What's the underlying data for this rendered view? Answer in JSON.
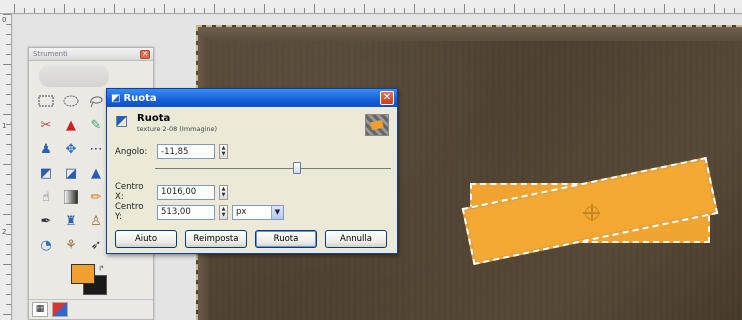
{
  "ruler": {
    "top_label": "",
    "left_labels": [
      "0",
      "1",
      "2"
    ]
  },
  "toolbox": {
    "title": "Strumenti",
    "close_glyph": "✕",
    "tools": [
      "rect-select-icon",
      "ellipse-select-icon",
      "lasso-icon",
      "fuzzy-select-icon",
      "bucket-select-icon",
      "scissors-icon",
      "crop-icon",
      "rotate-tool-icon",
      "scale-icon",
      "perspective-icon",
      "move-icon",
      "align-icon",
      "flip-icon",
      "text-icon",
      "smudge-icon",
      "clone-icon",
      "pencil-icon",
      "brush-icon",
      "eraser-icon",
      "airbrush-icon",
      "ink-icon",
      "dodge-icon",
      "bucket-fill-icon",
      "blend-icon"
    ],
    "fg_color": "#f0a030",
    "bg_color": "#1a1a1a"
  },
  "dialog": {
    "title": "Ruota",
    "close_glyph": "✕",
    "header_name": "Ruota",
    "header_sub": "texture 2-08 (Immagine)",
    "angle_label": "Angolo:",
    "angle_value": "-11,85",
    "center_x_label": "Centro X:",
    "center_x_value": "1016,00",
    "center_y_label": "Centro Y:",
    "center_y_value": "513,00",
    "unit": "px",
    "slider_position": 0.6,
    "buttons": {
      "help": "Aiuto",
      "reset": "Reimposta",
      "rotate": "Ruota",
      "cancel": "Annulla"
    }
  }
}
